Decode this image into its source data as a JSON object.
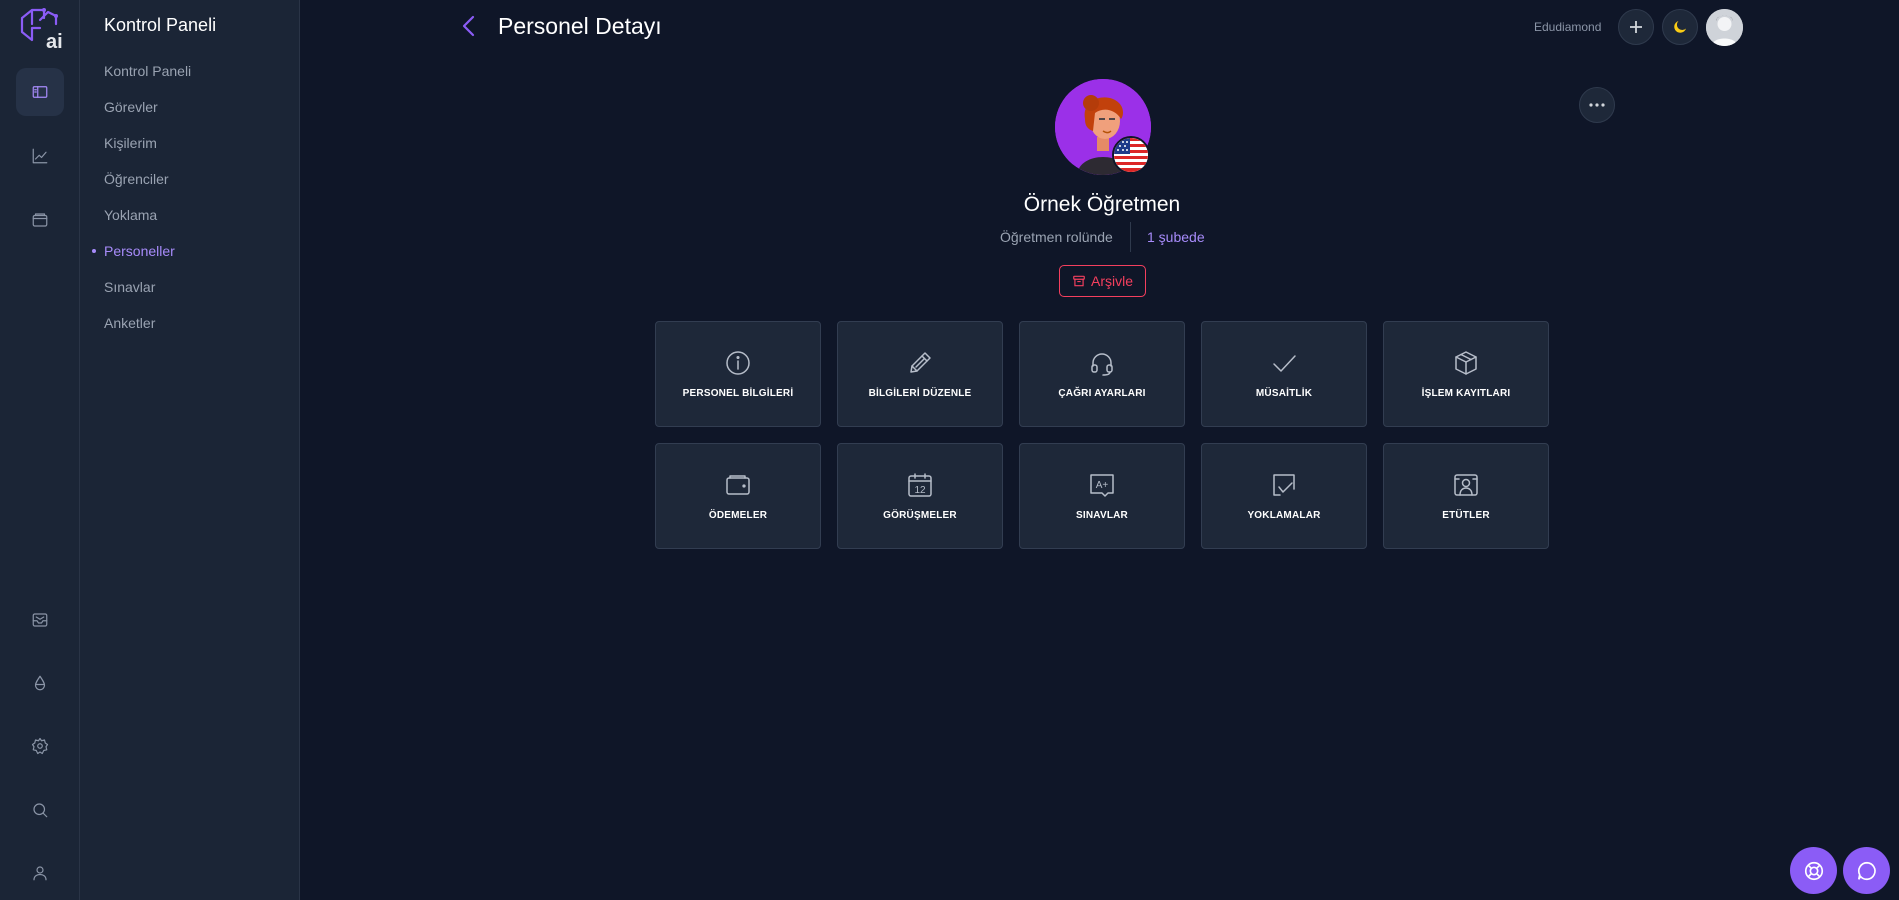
{
  "app": {
    "logo_text": "ai"
  },
  "rail": {
    "icons": [
      "layout-icon",
      "chart-icon",
      "wallet-icon",
      "inbox-icon",
      "drop-icon",
      "gear-icon",
      "search-icon",
      "user-icon"
    ]
  },
  "sidebar": {
    "title": "Kontrol Paneli",
    "items": [
      {
        "label": "Kontrol Paneli"
      },
      {
        "label": "Görevler"
      },
      {
        "label": "Kişilerim"
      },
      {
        "label": "Öğrenciler"
      },
      {
        "label": "Yoklama"
      },
      {
        "label": "Personeller",
        "active": true
      },
      {
        "label": "Sınavlar"
      },
      {
        "label": "Anketler"
      }
    ]
  },
  "header": {
    "title": "Personel Detayı",
    "brand": "Edudiamond"
  },
  "profile": {
    "name": "Örnek Öğretmen",
    "role": "Öğretmen rolünde",
    "branch": "1 şubede",
    "archive_label": "Arşivle"
  },
  "cards": [
    {
      "label": "PERSONEL BİLGİLERİ",
      "icon": "info-icon"
    },
    {
      "label": "BİLGİLERİ DÜZENLE",
      "icon": "pencil-icon"
    },
    {
      "label": "ÇAĞRI AYARLARI",
      "icon": "headset-icon"
    },
    {
      "label": "MÜSAİTLİK",
      "icon": "check-icon"
    },
    {
      "label": "İŞLEM KAYITLARI",
      "icon": "box-icon"
    },
    {
      "label": "ÖDEMELER",
      "icon": "wallet-icon"
    },
    {
      "label": "GÖRÜŞMELER",
      "icon": "calendar-icon"
    },
    {
      "label": "SINAVLAR",
      "icon": "grade-icon"
    },
    {
      "label": "YOKLAMALAR",
      "icon": "attendance-icon"
    },
    {
      "label": "ETÜTLER",
      "icon": "study-icon"
    }
  ],
  "calendar_day": "12",
  "grade_text": "A+",
  "colors": {
    "accent": "#a78bfa",
    "danger": "#f43f5e",
    "bg": "#0f1628",
    "panel": "#1b2536",
    "card": "#1e2839"
  }
}
